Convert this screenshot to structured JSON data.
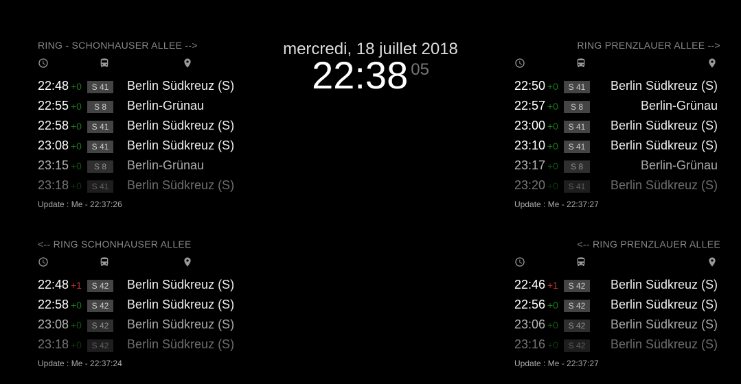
{
  "clock": {
    "date": "mercredi, 18 juillet 2018",
    "hhmm": "22:38",
    "ss": "05"
  },
  "panels": [
    {
      "id": "tl",
      "pos": "panel left top",
      "title": "RING - SCHONHAUSER ALLEE -->",
      "update": "Update : Me - 22:37:26",
      "rows": [
        {
          "t": "22:48",
          "d": "+0",
          "dc": "g",
          "line": "S 41",
          "dest": "Berlin Südkreuz (S)",
          "f": 0
        },
        {
          "t": "22:55",
          "d": "+0",
          "dc": "g",
          "line": "S 8",
          "dest": "Berlin-Grünau",
          "f": 0
        },
        {
          "t": "22:58",
          "d": "+0",
          "dc": "g",
          "line": "S 41",
          "dest": "Berlin Südkreuz (S)",
          "f": 0
        },
        {
          "t": "23:08",
          "d": "+0",
          "dc": "g",
          "line": "S 41",
          "dest": "Berlin Südkreuz (S)",
          "f": 0
        },
        {
          "t": "23:15",
          "d": "+0",
          "dc": "g",
          "line": "S 8",
          "dest": "Berlin-Grünau",
          "f": 1
        },
        {
          "t": "23:18",
          "d": "+0",
          "dc": "g",
          "line": "S 41",
          "dest": "Berlin Südkreuz (S)",
          "f": 2
        }
      ]
    },
    {
      "id": "tr",
      "pos": "panel right top",
      "title": "RING PRENZLAUER ALLEE -->",
      "update": "Update : Me - 22:37:27",
      "rows": [
        {
          "t": "22:50",
          "d": "+0",
          "dc": "g",
          "line": "S 41",
          "dest": "Berlin Südkreuz (S)",
          "f": 0
        },
        {
          "t": "22:57",
          "d": "+0",
          "dc": "g",
          "line": "S 8",
          "dest": "Berlin-Grünau",
          "f": 0
        },
        {
          "t": "23:00",
          "d": "+0",
          "dc": "g",
          "line": "S 41",
          "dest": "Berlin Südkreuz (S)",
          "f": 0
        },
        {
          "t": "23:10",
          "d": "+0",
          "dc": "g",
          "line": "S 41",
          "dest": "Berlin Südkreuz (S)",
          "f": 0
        },
        {
          "t": "23:17",
          "d": "+0",
          "dc": "g",
          "line": "S 8",
          "dest": "Berlin-Grünau",
          "f": 1
        },
        {
          "t": "23:20",
          "d": "+0",
          "dc": "g",
          "line": "S 41",
          "dest": "Berlin Südkreuz (S)",
          "f": 2
        }
      ]
    },
    {
      "id": "bl",
      "pos": "panel left bottom",
      "title": "<-- RING SCHONHAUSER ALLEE",
      "update": "Update : Me - 22:37:24",
      "rows": [
        {
          "t": "22:48",
          "d": "+1",
          "dc": "r",
          "line": "S 42",
          "dest": "Berlin Südkreuz (S)",
          "f": 0
        },
        {
          "t": "22:58",
          "d": "+0",
          "dc": "g",
          "line": "S 42",
          "dest": "Berlin Südkreuz (S)",
          "f": 0
        },
        {
          "t": "23:08",
          "d": "+0",
          "dc": "g",
          "line": "S 42",
          "dest": "Berlin Südkreuz (S)",
          "f": 1
        },
        {
          "t": "23:18",
          "d": "+0",
          "dc": "g",
          "line": "S 42",
          "dest": "Berlin Südkreuz (S)",
          "f": 2
        }
      ]
    },
    {
      "id": "br",
      "pos": "panel right bottom",
      "title": "<-- RING PRENZLAUER ALLEE",
      "update": "Update : Me - 22:37:27",
      "rows": [
        {
          "t": "22:46",
          "d": "+1",
          "dc": "r",
          "line": "S 42",
          "dest": "Berlin Südkreuz (S)",
          "f": 0
        },
        {
          "t": "22:56",
          "d": "+0",
          "dc": "g",
          "line": "S 42",
          "dest": "Berlin Südkreuz (S)",
          "f": 0
        },
        {
          "t": "23:06",
          "d": "+0",
          "dc": "g",
          "line": "S 42",
          "dest": "Berlin Südkreuz (S)",
          "f": 1
        },
        {
          "t": "23:16",
          "d": "+0",
          "dc": "g",
          "line": "S 42",
          "dest": "Berlin Südkreuz (S)",
          "f": 2
        }
      ]
    }
  ]
}
